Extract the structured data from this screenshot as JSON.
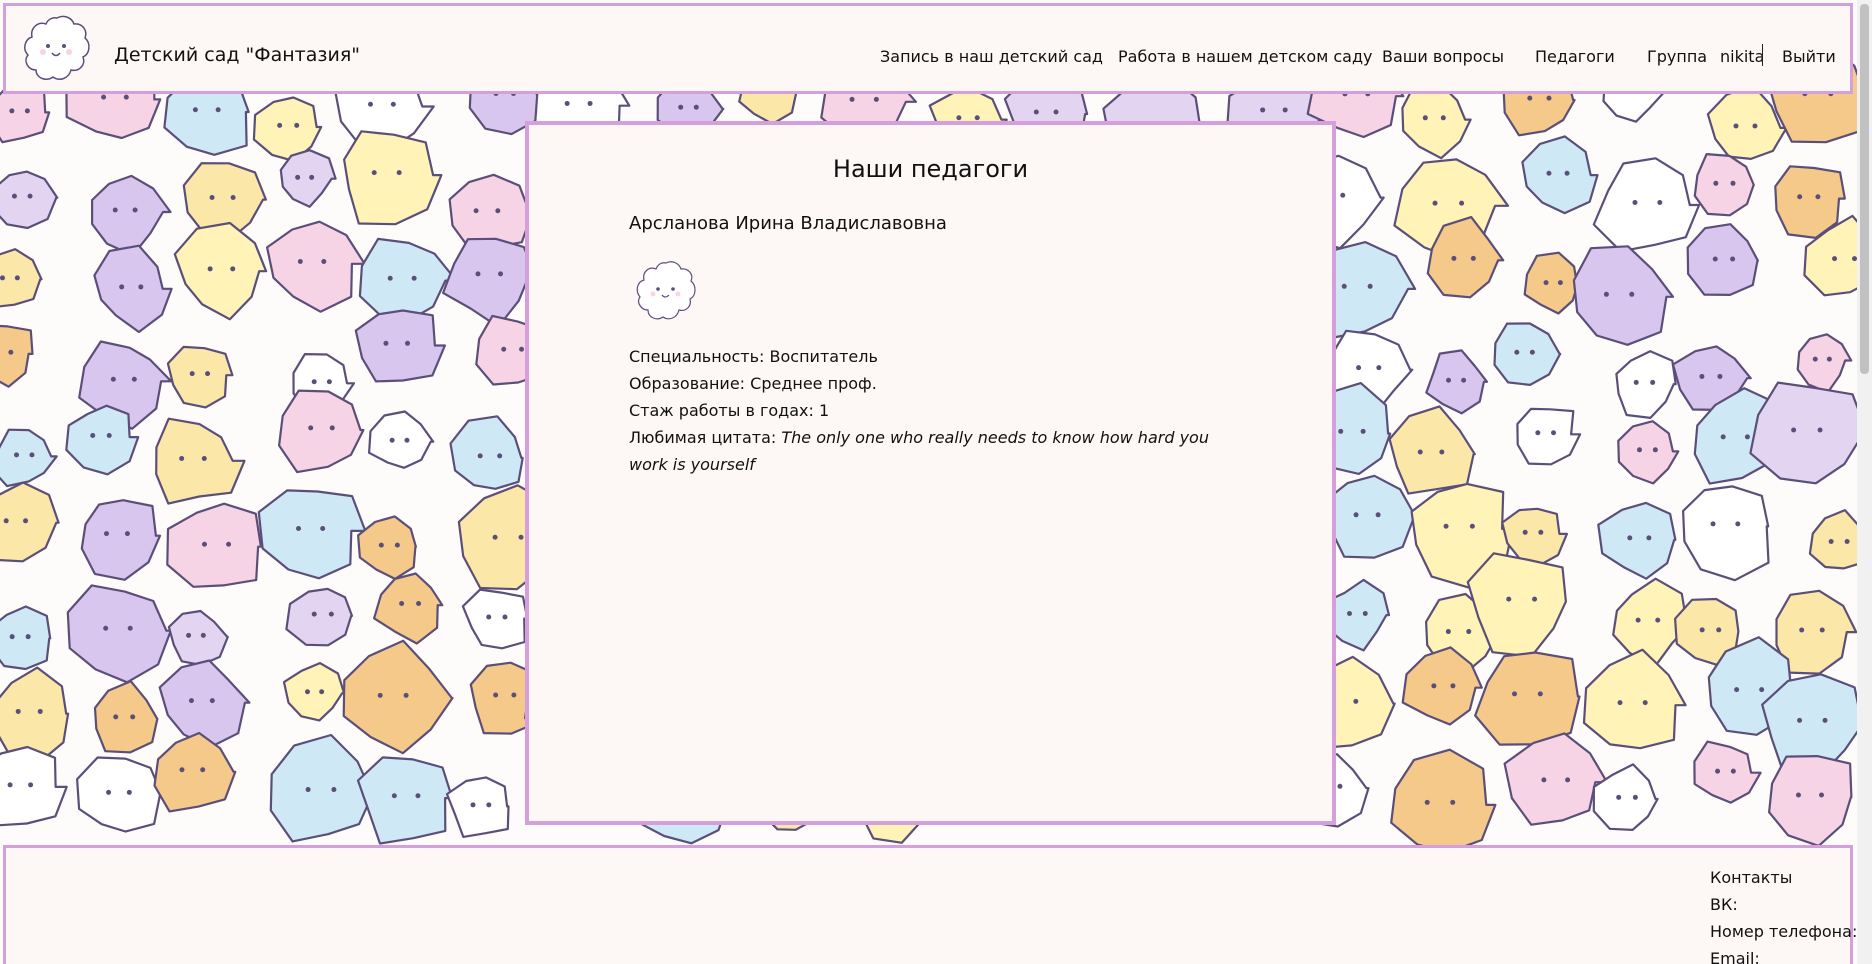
{
  "header": {
    "site_title": "Детский сад \"Фантазия\"",
    "logo_icon": "cloud-mascot-logo",
    "nav": [
      {
        "label": "Запись в наш детский сад",
        "name": "nav-enrollment"
      },
      {
        "label": "Работа в нашем детском саду",
        "name": "nav-jobs"
      },
      {
        "label": "Ваши вопросы",
        "name": "nav-questions"
      },
      {
        "label": "Педагоги",
        "name": "nav-teachers"
      },
      {
        "label": "Группа",
        "name": "nav-group"
      }
    ],
    "user": "nikita",
    "logout": "Выйти"
  },
  "main": {
    "page_title": "Наши педагоги",
    "teacher": {
      "name": "Арсланова Ирина Владиславовна",
      "photo_icon": "cloud-mascot-photo",
      "specialty_label": "Специальность:",
      "specialty": "Воспитатель",
      "education_label": "Образование:",
      "education": "Среднее проф.",
      "experience_label": "Стаж работы в годах:",
      "experience": "1",
      "quote_label": "Любимая цитата:",
      "quote": "The only one who really needs to know how hard you work is yourself"
    }
  },
  "footer": {
    "contacts_title": "Контакты",
    "vk_label": "ВК:",
    "phone_label": "Номер телефона:",
    "email_label": "Email:"
  },
  "colors": {
    "accent_border": "#d59fdc",
    "panel_bg": "#fdf7f6",
    "doodle_outline": "#5b4f7a"
  }
}
